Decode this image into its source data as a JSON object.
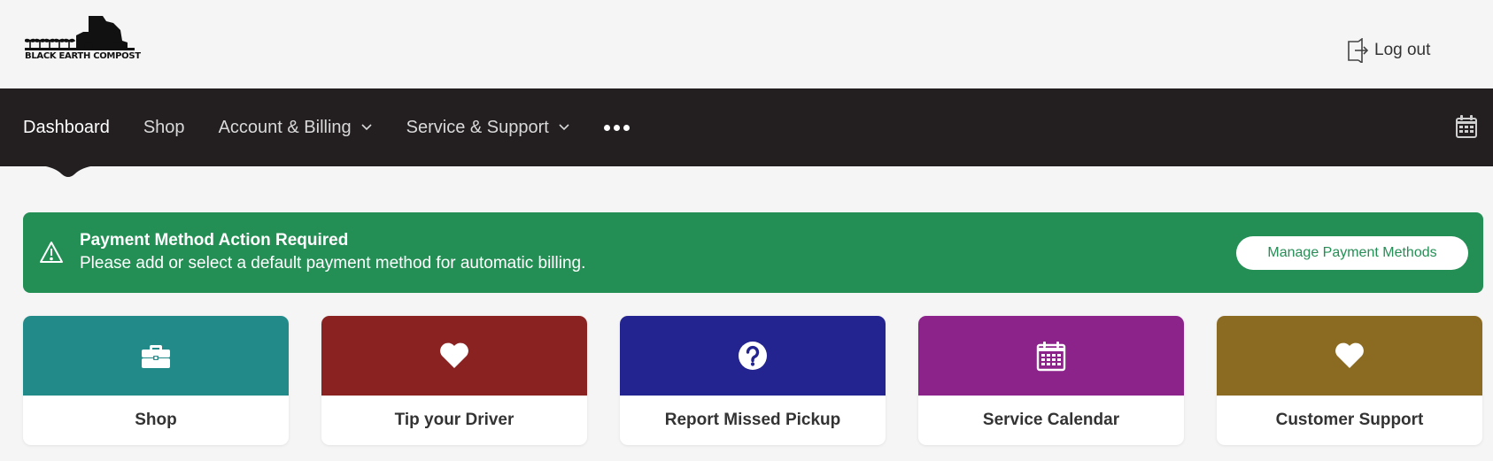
{
  "header": {
    "logo_text": "BLACK EARTH COMPOST",
    "logout_label": "Log out"
  },
  "nav": {
    "items": [
      {
        "label": "Dashboard",
        "active": true
      },
      {
        "label": "Shop"
      },
      {
        "label": "Account & Billing",
        "dropdown": true
      },
      {
        "label": "Service & Support",
        "dropdown": true
      }
    ],
    "more_icon": "ellipsis-icon",
    "right_icon": "calendar-icon"
  },
  "alert": {
    "title": "Payment Method Action Required",
    "message": "Please add or select a default payment method for automatic billing.",
    "button_label": "Manage Payment Methods",
    "icon": "warning-icon",
    "color": "#248f55"
  },
  "cards": [
    {
      "label": "Shop",
      "icon": "briefcase-icon",
      "color": "#238a8a"
    },
    {
      "label": "Tip your Driver",
      "icon": "heart-icon",
      "color": "#8b2222"
    },
    {
      "label": "Report Missed Pickup",
      "icon": "question-circle-icon",
      "color": "#242490"
    },
    {
      "label": "Service Calendar",
      "icon": "calendar-icon",
      "color": "#8b238b"
    },
    {
      "label": "Customer Support",
      "icon": "heart-icon",
      "color": "#8b6a22"
    }
  ]
}
